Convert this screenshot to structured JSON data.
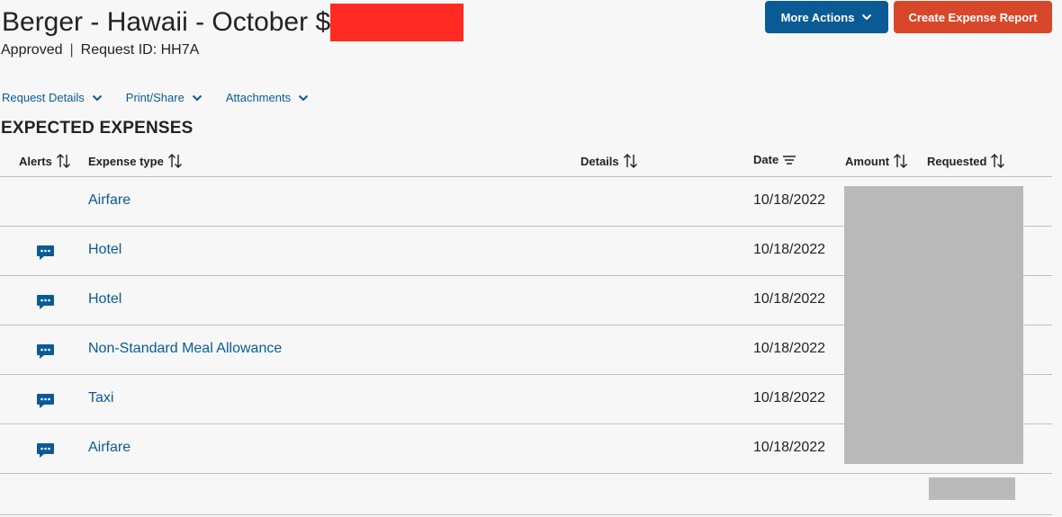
{
  "header": {
    "title": "Berger - Hawaii - October $",
    "status": "Approved",
    "separator": "|",
    "request_id": "Request ID: HH7A"
  },
  "actions": {
    "more_actions": "More Actions",
    "create_report": "Create Expense Report"
  },
  "subnav": [
    {
      "label": "Request Details"
    },
    {
      "label": "Print/Share"
    },
    {
      "label": "Attachments"
    }
  ],
  "section": {
    "title": "EXPECTED EXPENSES"
  },
  "table": {
    "columns": {
      "alerts": "Alerts",
      "expense_type": "Expense type",
      "details": "Details",
      "date": "Date",
      "amount": "Amount",
      "requested": "Requested"
    },
    "rows": [
      {
        "has_comment": false,
        "expense_type": "Airfare",
        "date": "10/18/2022"
      },
      {
        "has_comment": true,
        "expense_type": "Hotel",
        "date": "10/18/2022"
      },
      {
        "has_comment": true,
        "expense_type": "Hotel",
        "date": "10/18/2022"
      },
      {
        "has_comment": true,
        "expense_type": "Non-Standard Meal Allowance",
        "date": "10/18/2022"
      },
      {
        "has_comment": true,
        "expense_type": "Taxi",
        "date": "10/18/2022"
      },
      {
        "has_comment": true,
        "expense_type": "Airfare",
        "date": "10/18/2022"
      }
    ]
  },
  "colors": {
    "link": "#0a5a96",
    "primary_button": "#0a5a96",
    "create_button": "#d9472b",
    "redaction_red": "#ff2a22",
    "redaction_gray": "#b9b9b9"
  }
}
